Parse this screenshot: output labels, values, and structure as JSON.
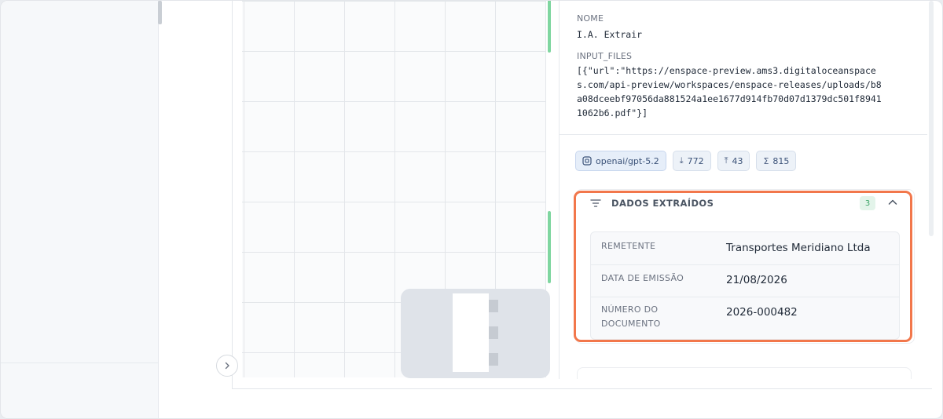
{
  "colors": {
    "highlight": "#f2774b",
    "badge_bg": "#e3f4ea",
    "badge_text": "#3fa66a",
    "chip_bg": "#edf2f8",
    "node_green": "#7fd6a0"
  },
  "collapse_button": {
    "icon": "chevron-right-icon"
  },
  "details": {
    "name_label": "NOME",
    "name_value": "I.A. Extrair",
    "input_files_label": "INPUT_FILES",
    "input_files_lines": [
      "[{\"url\":\"https://enspace-preview.ams3.digitaloceanspace",
      "s.com/api-preview/workspaces/enspace-releases/uploads/b8",
      "a08dceebf97056da881524a1ee1677d914fb70d07d1379dc501f8941",
      "1062b6.pdf\"}]"
    ]
  },
  "stats": {
    "model": "openai/gpt-5.2",
    "model_icon": "model-icon",
    "input_tokens": "772",
    "input_icon": "download-icon",
    "output_tokens": "43",
    "output_icon": "upload-icon",
    "total_tokens": "815",
    "total_icon": "sigma-icon"
  },
  "extracted": {
    "title": "DADOS EXTRAÍDOS",
    "count": "3",
    "rows": [
      {
        "key": "REMETENTE",
        "value": "Transportes Meridiano Ltda"
      },
      {
        "key": "DATA DE EMISSÃO",
        "value": "21/08/2026"
      },
      {
        "key": "NÚMERO DO DOCUMENTO",
        "key_lines": [
          "NÚMERO DO",
          "DOCUMENTO"
        ],
        "value": "2026-000482"
      }
    ]
  }
}
